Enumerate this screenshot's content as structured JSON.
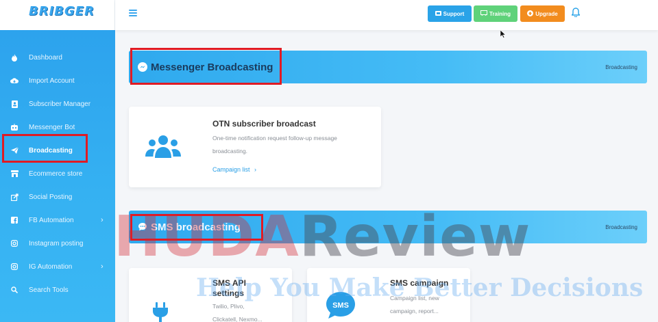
{
  "brand": {
    "logo_text": "BRIBGER"
  },
  "topbar": {
    "support_label": "Support",
    "training_label": "Training",
    "upgrade_label": "Upgrade",
    "colors": {
      "support": "#2aa3e8",
      "training": "#5fd27a",
      "upgrade": "#f28c1e"
    }
  },
  "sidebar": {
    "items": [
      {
        "label": "Dashboard",
        "icon": "fire-icon"
      },
      {
        "label": "Import Account",
        "icon": "cloud-download-icon"
      },
      {
        "label": "Subscriber Manager",
        "icon": "contact-book-icon"
      },
      {
        "label": "Messenger Bot",
        "icon": "robot-icon"
      },
      {
        "label": "Broadcasting",
        "icon": "paper-plane-icon",
        "active": true
      },
      {
        "label": "Ecommerce store",
        "icon": "store-icon"
      },
      {
        "label": "Social Posting",
        "icon": "share-icon"
      },
      {
        "label": "FB Automation",
        "icon": "facebook-icon",
        "has_arrow": true
      },
      {
        "label": "Instagram posting",
        "icon": "instagram-icon"
      },
      {
        "label": "IG Automation",
        "icon": "instagram-icon",
        "has_arrow": true
      },
      {
        "label": "Search Tools",
        "icon": "search-icon"
      }
    ]
  },
  "section1": {
    "title": "Messenger Broadcasting",
    "breadcrumb": "Broadcasting",
    "card": {
      "title": "OTN subscriber broadcast",
      "desc_line1": "One-time notification request follow-up message",
      "desc_line2": "broadcasting.",
      "link": "Campaign list"
    }
  },
  "section2": {
    "title": "SMS broadcasting",
    "breadcrumb": "Broadcasting",
    "card_api": {
      "title_line1": "SMS API",
      "title_line2": "settings",
      "desc_line1": "Twilio, Plivo,",
      "desc_line2": "Clickatell, Nexmo..."
    },
    "card_campaign": {
      "title": "SMS campaign",
      "icon_text": "SMS",
      "desc_line1": "Campaign list, new",
      "desc_line2": "campaign, report..."
    }
  },
  "watermark": {
    "line1_red": "HUDA",
    "line1_gray": "Review",
    "line2": "Help You Make Better Decisions"
  }
}
